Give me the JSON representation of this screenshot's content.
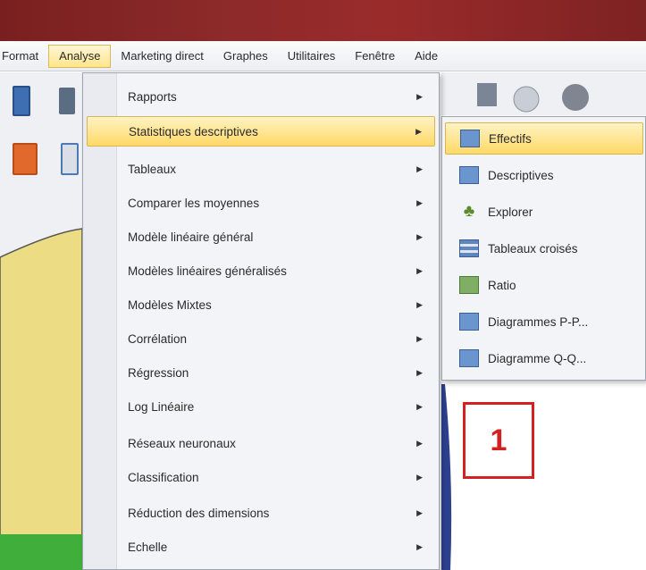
{
  "menubar": {
    "items": [
      "Format",
      "Analyse",
      "Marketing direct",
      "Graphes",
      "Utilitaires",
      "Fenêtre",
      "Aide"
    ],
    "active_index": 1
  },
  "analyse_menu": {
    "items": [
      {
        "label": "Rapports",
        "has_submenu": true
      },
      {
        "label": "Statistiques descriptives",
        "has_submenu": true,
        "active": true
      },
      {
        "label": "Tableaux",
        "has_submenu": true
      },
      {
        "label": "Comparer les moyennes",
        "has_submenu": true
      },
      {
        "label": "Modèle linéaire général",
        "has_submenu": true
      },
      {
        "label": "Modèles linéaires généralisés",
        "has_submenu": true
      },
      {
        "label": "Modèles Mixtes",
        "has_submenu": true
      },
      {
        "label": "Corrélation",
        "has_submenu": true
      },
      {
        "label": "Régression",
        "has_submenu": true
      },
      {
        "label": "Log Linéaire",
        "has_submenu": true
      },
      {
        "label": "Réseaux neuronaux",
        "has_submenu": true
      },
      {
        "label": "Classification",
        "has_submenu": true
      },
      {
        "label": "Réduction des dimensions",
        "has_submenu": true
      },
      {
        "label": "Echelle",
        "has_submenu": true
      }
    ]
  },
  "descriptives_submenu": {
    "items": [
      {
        "label": "Effectifs",
        "icon": "frequencies-icon",
        "active": true
      },
      {
        "label": "Descriptives",
        "icon": "descriptives-icon"
      },
      {
        "label": "Explorer",
        "icon": "explore-icon"
      },
      {
        "label": "Tableaux croisés",
        "icon": "crosstabs-icon"
      },
      {
        "label": "Ratio",
        "icon": "ratio-icon"
      },
      {
        "label": "Diagrammes P-P...",
        "icon": "pp-plots-icon"
      },
      {
        "label": "Diagramme Q-Q...",
        "icon": "qq-plots-icon"
      }
    ]
  },
  "annotation": {
    "label": "1",
    "color": "#d42020"
  },
  "colors": {
    "title_bar": "#8d2a2a",
    "highlight": "#ffd966"
  }
}
